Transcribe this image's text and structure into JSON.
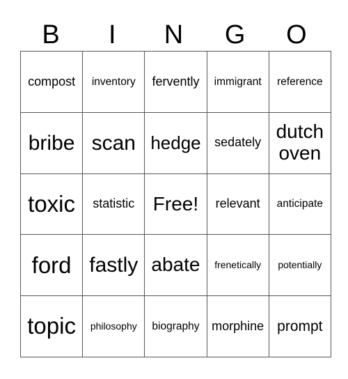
{
  "header": {
    "letters": [
      "B",
      "I",
      "N",
      "G",
      "O"
    ]
  },
  "card": {
    "rows": [
      [
        "compost",
        "inventory",
        "fervently",
        "immigrant",
        "reference"
      ],
      [
        "bribe",
        "scan",
        "hedge",
        "sedately",
        "dutch oven"
      ],
      [
        "toxic",
        "statistic",
        "Free!",
        "relevant",
        "anticipate"
      ],
      [
        "ford",
        "fastly",
        "abate",
        "frenetically",
        "potentially"
      ],
      [
        "topic",
        "philosophy",
        "biography",
        "morphine",
        "prompt"
      ]
    ]
  }
}
